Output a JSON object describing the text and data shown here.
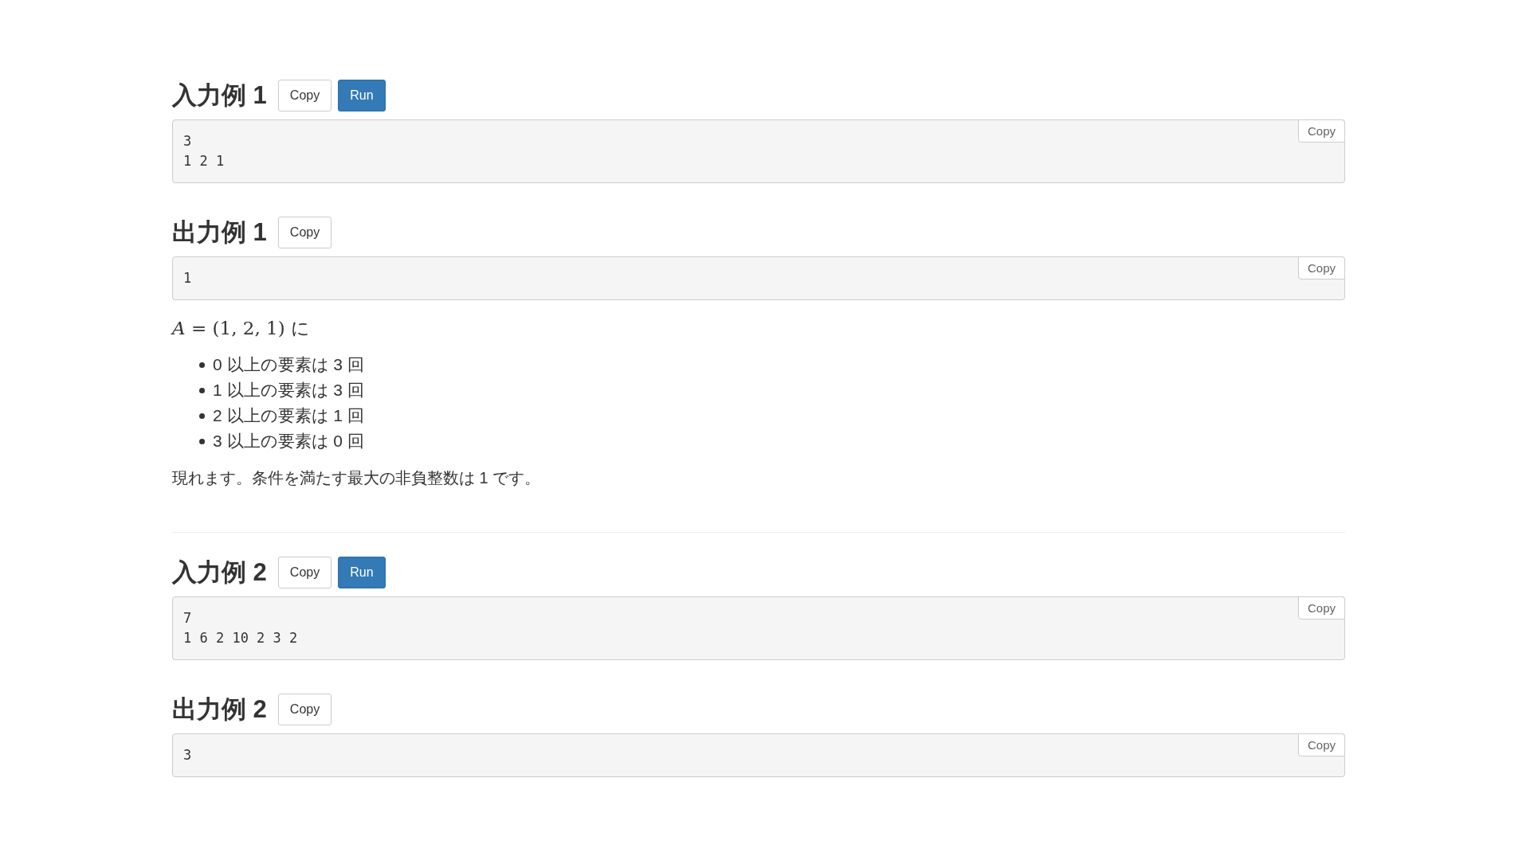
{
  "examples": [
    {
      "blocks": [
        {
          "kind": "sample",
          "title": "入力例 1",
          "buttons": [
            {
              "label": "Copy",
              "kind": "default"
            },
            {
              "label": "Run",
              "kind": "primary"
            }
          ],
          "lines": [
            "3",
            "1 2 1"
          ],
          "copy_label": "Copy"
        },
        {
          "kind": "sample",
          "title": "出力例 1",
          "buttons": [
            {
              "label": "Copy",
              "kind": "default"
            }
          ],
          "lines": [
            "1"
          ],
          "copy_label": "Copy"
        },
        {
          "kind": "explanation",
          "intro": "*A* = (1, 2, 1) に",
          "items": [
            "0 以上の要素は 3 回",
            "1 以上の要素は 3 回",
            "2 以上の要素は 1 回",
            "3 以上の要素は 0 回"
          ],
          "conclusion": "現れます。条件を満たす最大の非負整数は 1 です。"
        }
      ]
    },
    {
      "blocks": [
        {
          "kind": "sample",
          "title": "入力例 2",
          "buttons": [
            {
              "label": "Copy",
              "kind": "default"
            },
            {
              "label": "Run",
              "kind": "primary"
            }
          ],
          "lines": [
            "7",
            "1 6 2 10 2 3 2"
          ],
          "copy_label": "Copy"
        },
        {
          "kind": "sample",
          "title": "出力例 2",
          "buttons": [
            {
              "label": "Copy",
              "kind": "default"
            }
          ],
          "lines": [
            "3"
          ],
          "copy_label": "Copy"
        }
      ]
    }
  ]
}
